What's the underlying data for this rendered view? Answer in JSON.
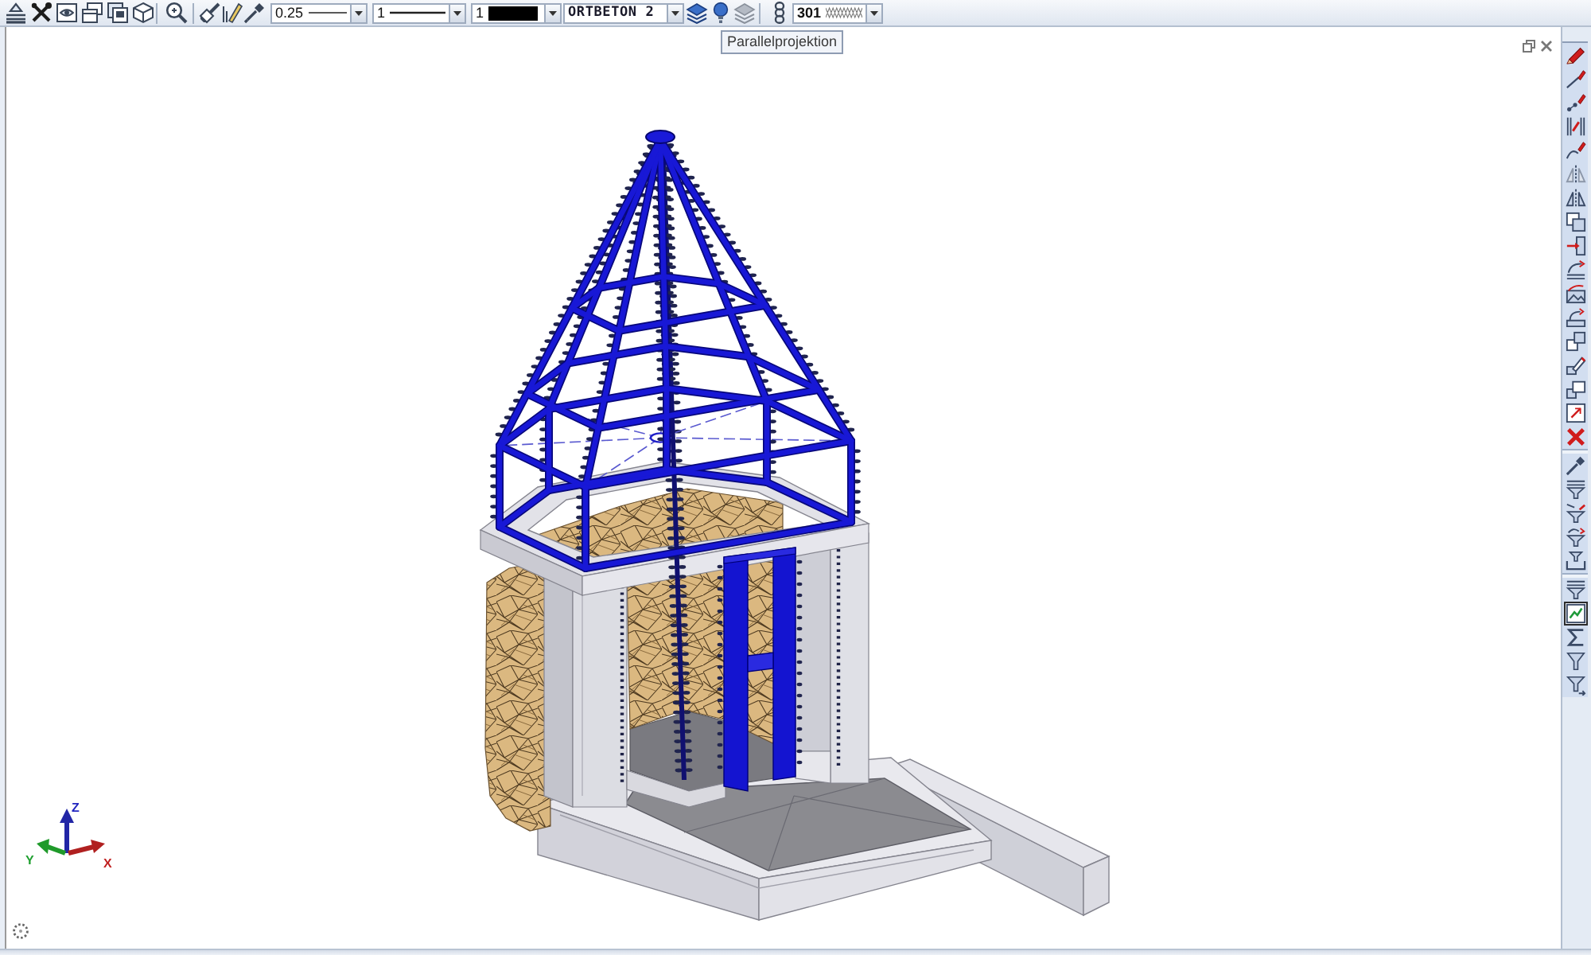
{
  "toolbar": {
    "combos": [
      {
        "kind": "pen",
        "value": "0.25"
      },
      {
        "kind": "line",
        "value": "1"
      },
      {
        "kind": "color",
        "value": "1",
        "color": "#000000"
      },
      {
        "kind": "material",
        "value": "ORTBETON 2"
      },
      {
        "kind": "hatch",
        "value": "301"
      }
    ]
  },
  "tooltip": "Parallelprojektion",
  "side_toolbar": {
    "groups": [
      {
        "tools": [
          {
            "selected": false
          },
          {
            "selected": false
          },
          {
            "selected": false
          },
          {
            "selected": false
          },
          {
            "selected": false
          },
          {
            "selected": false
          },
          {
            "selected": false
          },
          {
            "selected": false
          },
          {
            "selected": false
          },
          {
            "selected": false
          },
          {
            "selected": false
          },
          {
            "selected": false
          },
          {
            "selected": false
          },
          {
            "selected": false
          },
          {
            "selected": false
          },
          {
            "selected": false
          },
          {
            "selected": false
          }
        ]
      },
      {
        "tools": [
          {
            "selected": false
          },
          {
            "selected": false
          },
          {
            "selected": false
          },
          {
            "selected": false
          },
          {
            "selected": false
          }
        ]
      },
      {
        "tools": [
          {
            "selected": false
          },
          {
            "selected": true
          },
          {
            "selected": false
          },
          {
            "selected": false
          },
          {
            "selected": false
          }
        ]
      }
    ]
  },
  "axes": {
    "z": "Z",
    "x": "X",
    "y": "Y"
  }
}
